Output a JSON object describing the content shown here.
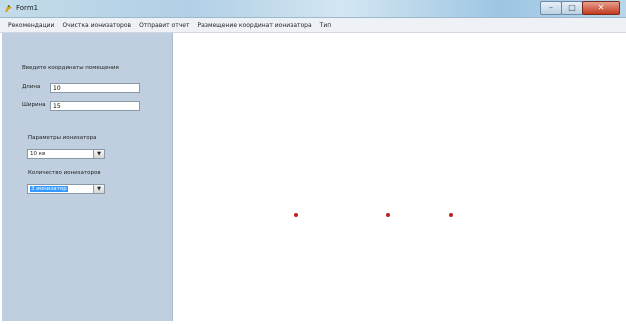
{
  "window": {
    "title": "Form1",
    "controls": {
      "minimize_icon": "minimize-icon",
      "maximize_icon": "maximize-icon",
      "close_icon": "close-icon"
    }
  },
  "menu": {
    "items": [
      "Рекомендации",
      "Очистка ионизаторов",
      "Отправит отчет",
      "Размещение координат ионизатора",
      "Тип"
    ]
  },
  "sidebar": {
    "room_heading": "Введите координаты помещения",
    "length_label": "Длина",
    "length_value": "10",
    "width_label": "Ширина",
    "width_value": "15",
    "ionizer_params_label": "Параметры ионизатора",
    "ionizer_params_value": "10 кв",
    "ionizer_count_label": "Количество ионизаторов",
    "ionizer_count_value": "3 ионизатор"
  },
  "canvas": {
    "points_count": 3,
    "point_color": "#c42121"
  },
  "colors": {
    "sidebar_bg": "#bfcfdf",
    "selection": "#3399ff"
  }
}
